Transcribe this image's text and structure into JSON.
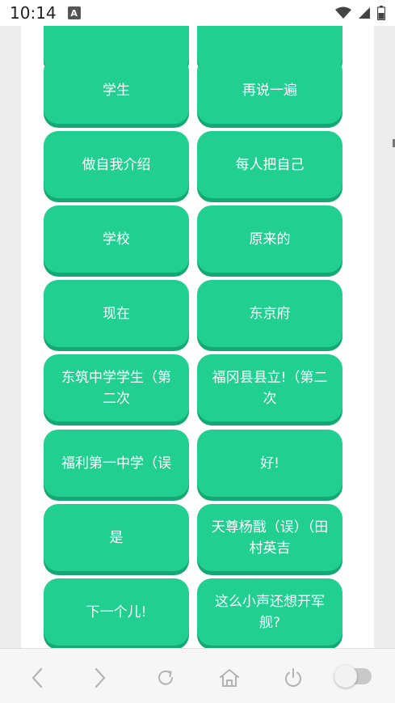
{
  "status_bar": {
    "time": "10:14",
    "notification_letter": "A"
  },
  "words": [
    {
      "label": ""
    },
    {
      "label": ""
    },
    {
      "label": "学生"
    },
    {
      "label": "再说一遍"
    },
    {
      "label": "做自我介绍"
    },
    {
      "label": "每人把自己"
    },
    {
      "label": "学校"
    },
    {
      "label": "原来的"
    },
    {
      "label": "现在"
    },
    {
      "label": "东京府"
    },
    {
      "label": "东筑中学学生（第二次"
    },
    {
      "label": "福冈县县立!（第二次"
    },
    {
      "label": "福利第一中学（误"
    },
    {
      "label": "好!"
    },
    {
      "label": "是"
    },
    {
      "label": "天尊杨戬（误）（田村英吉"
    },
    {
      "label": "下一个儿!"
    },
    {
      "label": "这么小声还想开军舰?"
    }
  ],
  "colors": {
    "button": "#21cf91",
    "button_shadow": "#16a872",
    "panel": "#ffffff",
    "background": "#ececec"
  },
  "bottom_nav": {
    "items": [
      "back-icon",
      "forward-icon",
      "refresh-icon",
      "home-icon",
      "power-icon"
    ],
    "toggle_on": false
  }
}
